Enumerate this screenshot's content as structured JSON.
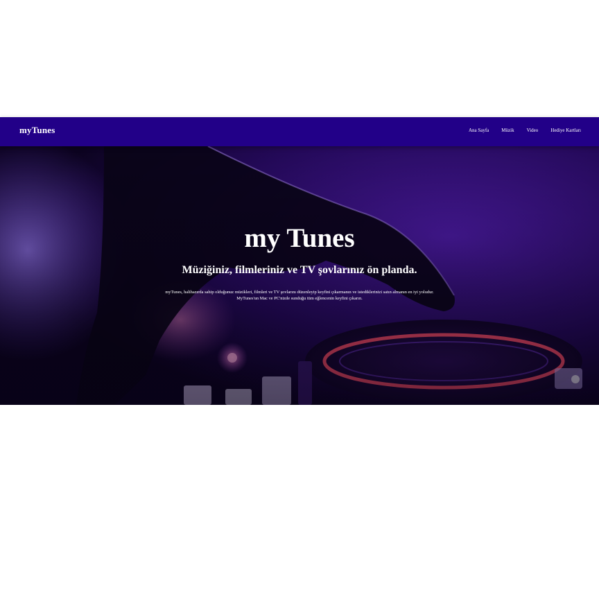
{
  "navbar": {
    "brand": "myTunes",
    "links": [
      "Ana Sayfa",
      "Müzik",
      "Video",
      "Hediye Kartları"
    ]
  },
  "hero": {
    "title": "my Tunes",
    "subtitle": "Müziğiniz, filmleriniz ve TV şovlarınız ön planda.",
    "description": "myTunes, halihazırda sahip olduğunuz müzikleri, filmleri ve TV şovlarını düzenleyip keyfini çıkarmanın ve istediklerinizi satın almanın en iyi yoludur. MyTunes'un Mac ve PC'nizde sunduğu tüm eğlencenin keyfini çıkarın."
  },
  "colors": {
    "navbar_bg": "#220088",
    "hero_tint": "#3a0a8a",
    "turntable_ring": "#ff4f6a"
  }
}
